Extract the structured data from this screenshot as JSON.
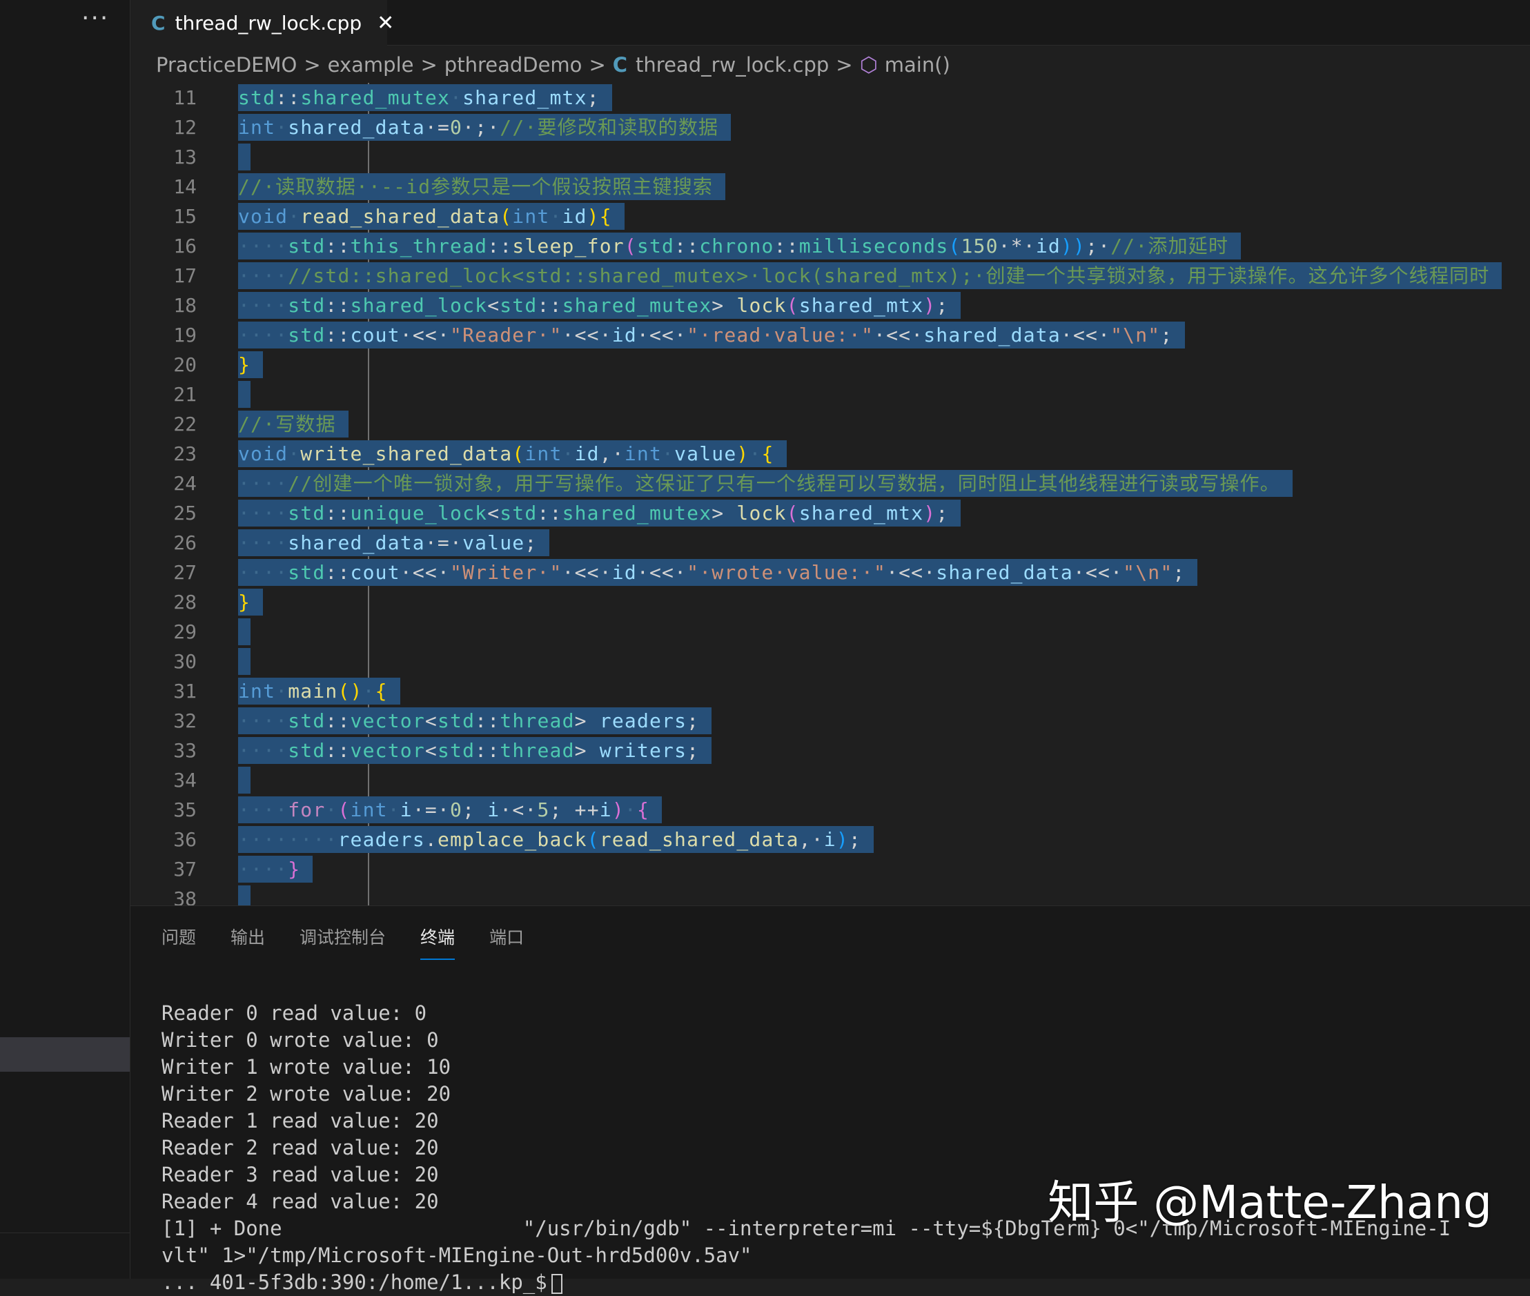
{
  "sidebar": {
    "more_label": "···"
  },
  "tab": {
    "icon": "C",
    "title": "thread_rw_lock.cpp",
    "close": "✕"
  },
  "breadcrumb": {
    "items": [
      "PracticeDEMO",
      "example",
      "pthreadDemo",
      "thread_rw_lock.cpp",
      "main()"
    ],
    "separator": ">",
    "file_icon": "C",
    "symbol_icon": "⬡"
  },
  "code": {
    "line_numbers": [
      "11",
      "12",
      "13",
      "14",
      "15",
      "16",
      "17",
      "18",
      "19",
      "20",
      "21",
      "22",
      "23",
      "24",
      "25",
      "26",
      "27",
      "28",
      "29",
      "30",
      "31",
      "32",
      "33",
      "34",
      "35",
      "36",
      "37",
      "38"
    ],
    "l11": [
      "std",
      "::",
      "shared_mutex",
      "·",
      "shared_mtx",
      ";"
    ],
    "l12": [
      "int",
      "·",
      "shared_data",
      "·=",
      "0",
      "·;·",
      "//·要修改和读取的数据"
    ],
    "l14": [
      "//·读取数据··--id参数只是一个假设按照主键搜索"
    ],
    "l15": [
      "void",
      "·",
      "read_shared_data",
      "(",
      "int",
      "·",
      "id",
      ")",
      "{"
    ],
    "l16": [
      "····",
      "std",
      "::",
      "this_thread",
      "::",
      "sleep_for",
      "(",
      "std",
      "::",
      "chrono",
      "::",
      "milliseconds",
      "(",
      "150",
      "·*·",
      "id",
      "))",
      ";·",
      "//·添加延时"
    ],
    "l17": [
      "····",
      "//std::shared_lock<std::shared_mutex>·lock(shared_mtx);·创建一个共享锁对象，用于读操作。这允许多个线程同时"
    ],
    "l18": [
      "····",
      "std",
      "::",
      "shared_lock",
      "<",
      "std",
      "::",
      "shared_mutex",
      "> ",
      "lock",
      "(",
      "shared_mtx",
      ")",
      ";"
    ],
    "l19": [
      "····",
      "std",
      "::",
      "cout",
      "·<<·",
      "\"Reader·\"",
      "·<<·",
      "id",
      "·<<·",
      "\"·read·value:·\"",
      "·<<·",
      "shared_data",
      "·<<·",
      "\"\\n\"",
      ";"
    ],
    "l20": [
      "}"
    ],
    "l22": [
      "//·写数据"
    ],
    "l23": [
      "void",
      "·",
      "write_shared_data",
      "(",
      "int",
      "·",
      "id",
      ",·",
      "int",
      "·",
      "value",
      ")",
      "·",
      "{"
    ],
    "l24": [
      "····",
      "//创建一个唯一锁对象，用于写操作。这保证了只有一个线程可以写数据，同时阻止其他线程进行读或写操作。"
    ],
    "l25": [
      "····",
      "std",
      "::",
      "unique_lock",
      "<",
      "std",
      "::",
      "shared_mutex",
      "> ",
      "lock",
      "(",
      "shared_mtx",
      ")",
      ";"
    ],
    "l26": [
      "····",
      "shared_data",
      "·=·",
      "value",
      ";"
    ],
    "l27": [
      "····",
      "std",
      "::",
      "cout",
      "·<<·",
      "\"Writer·\"",
      "·<<·",
      "id",
      "·<<·",
      "\"·wrote·value:·\"",
      "·<<·",
      "shared_data",
      "·<<·",
      "\"\\n\"",
      ";"
    ],
    "l28": [
      "}"
    ],
    "l31": [
      "int",
      "·",
      "main",
      "()",
      "·",
      "{"
    ],
    "l32": [
      "····",
      "std",
      "::",
      "vector",
      "<",
      "std",
      "::",
      "thread",
      "> ",
      "readers",
      ";"
    ],
    "l33": [
      "····",
      "std",
      "::",
      "vector",
      "<",
      "std",
      "::",
      "thread",
      "> ",
      "writers",
      ";"
    ],
    "l35": [
      "····",
      "for",
      "·",
      "(",
      "int",
      "·",
      "i",
      "·=·",
      "0",
      "; ",
      "i",
      "·<·",
      "5",
      "; ",
      "++",
      "i",
      ")",
      "·",
      "{"
    ],
    "l36": [
      "········",
      "readers",
      ".",
      "emplace_back",
      "(",
      "read_shared_data",
      ",·",
      "i",
      ")",
      ";"
    ],
    "l37": [
      "····",
      "}"
    ]
  },
  "panel": {
    "tabs": [
      "问题",
      "输出",
      "调试控制台",
      "终端",
      "端口"
    ],
    "active_tab": "终端",
    "terminal_lines": [
      "Reader 0 read value: 0",
      "Writer 0 wrote value: 0",
      "Writer 1 wrote value: 10",
      "Writer 2 wrote value: 20",
      "Reader 1 read value: 20",
      "Reader 2 read value: 20",
      "Reader 3 read value: 20",
      "Reader 4 read value: 20",
      "[1] + Done                    \"/usr/bin/gdb\" --interpreter=mi --tty=${DbgTerm} 0<\"/tmp/Microsoft-MIEngine-I",
      "vlt\" 1>\"/tmp/Microsoft-MIEngine-Out-hrd5d00v.5av\"",
      "... 401-5f3db:390:/home/1...kp_$"
    ]
  },
  "watermark": "知乎 @Matte-Zhang",
  "colors": {
    "background": "#1f1f1f",
    "selection": "#264f78",
    "keyword": "#569cd6",
    "function": "#dcdcaa",
    "type": "#4ec9b0",
    "variable": "#9cdcfe",
    "string": "#ce9178",
    "comment": "#6a9955",
    "number": "#b5cea8",
    "control": "#c586c0",
    "accent": "#0078d4"
  }
}
